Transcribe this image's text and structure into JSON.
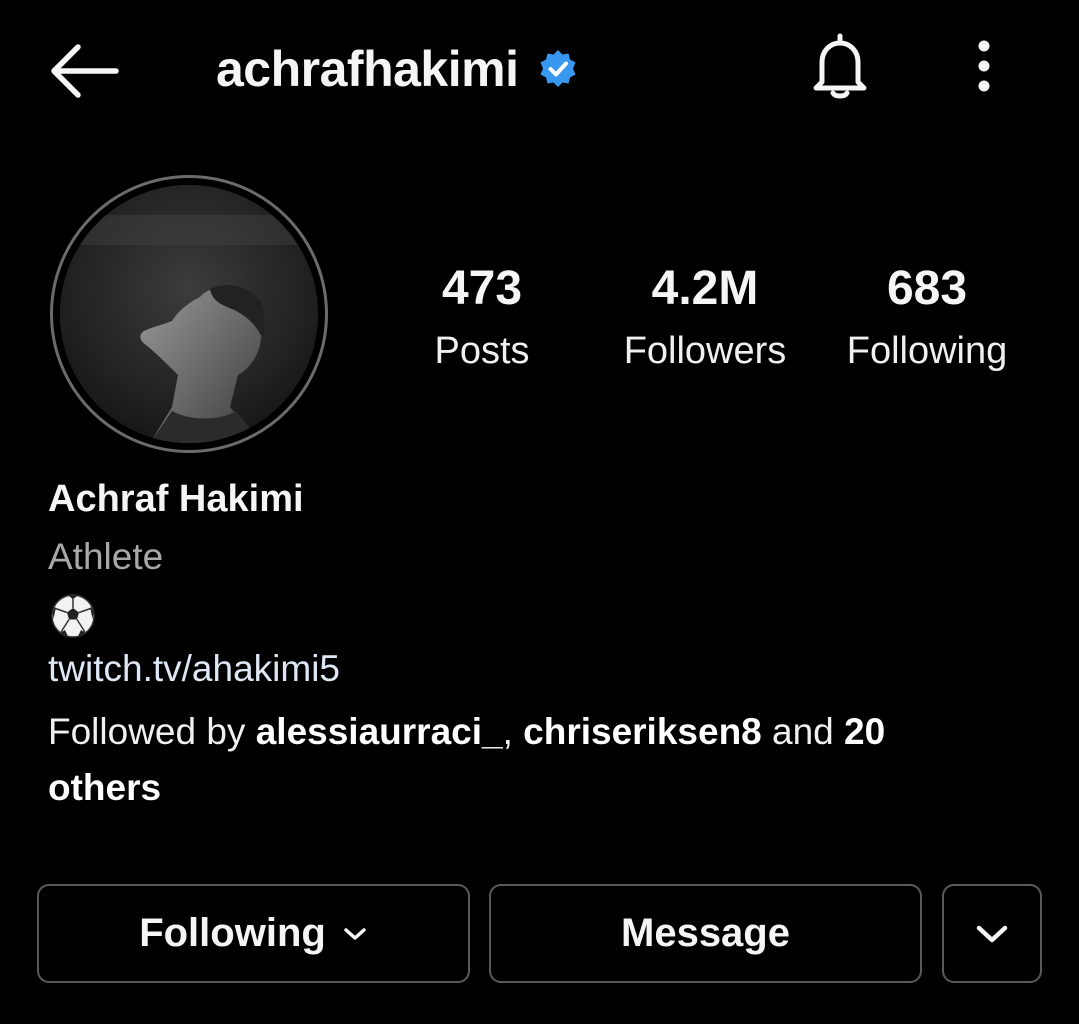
{
  "header": {
    "back_icon": "arrow-left-icon",
    "username": "achrafhakimi",
    "verified_icon": "verified-badge-icon",
    "bell_icon": "bell-icon",
    "more_icon": "more-vertical-icon"
  },
  "profile": {
    "avatar_alt": "profile-photo",
    "stats": [
      {
        "value": "473",
        "label": "Posts"
      },
      {
        "value": "4.2M",
        "label": "Followers"
      },
      {
        "value": "683",
        "label": "Following"
      }
    ],
    "name": "Achraf Hakimi",
    "category": "Athlete",
    "bio_emoji": "⚽",
    "link": "twitch.tv/ahakimi5",
    "followed_by": {
      "prefix": "Followed by ",
      "user1": "alessiaurraci_",
      "separator": ", ",
      "user2": "chriseriksen8",
      "connector": " and ",
      "count": "20",
      "suffix": "others"
    }
  },
  "actions": {
    "following_label": "Following",
    "message_label": "Message",
    "suggest_icon": "chevron-down-icon"
  },
  "colors": {
    "background": "#000000",
    "verified": "#3897f0",
    "link": "#dfe7f5",
    "muted": "#a8a8a8",
    "border": "#5a5a5a"
  }
}
